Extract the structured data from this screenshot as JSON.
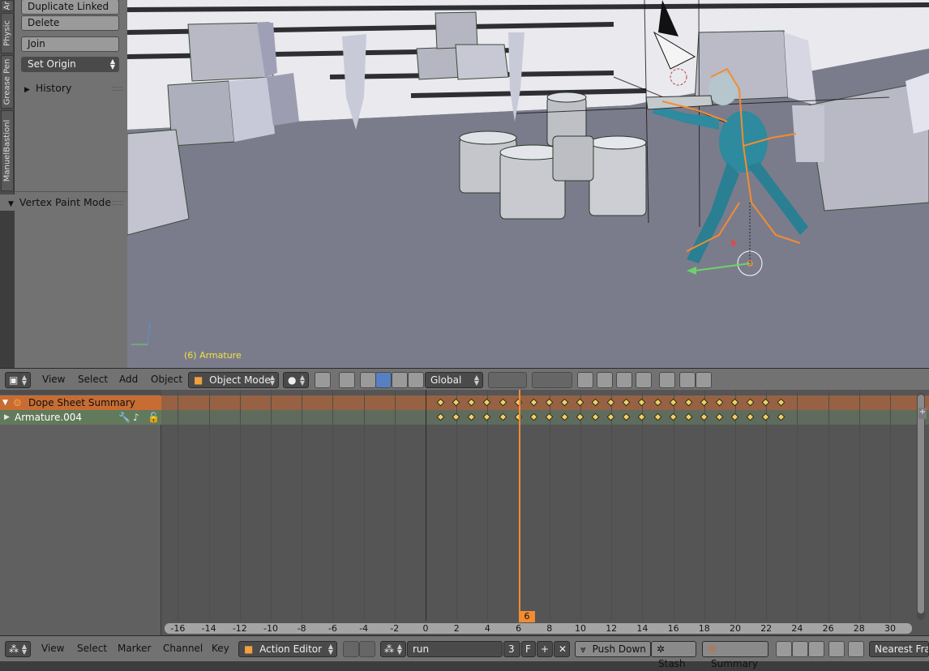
{
  "tool_panel": {
    "tabs": [
      "Ar",
      "Physic",
      "Grease Pen",
      "ManuelBastionl"
    ],
    "buttons": {
      "duplicate_linked": "Duplicate Linked",
      "delete": "Delete",
      "join": "Join",
      "set_origin": "Set Origin"
    },
    "history_label": "History",
    "vertex_paint_label": "Vertex Paint Mode"
  },
  "viewport": {
    "object_label": "(6) Armature"
  },
  "view3d_header": {
    "menus": [
      "View",
      "Select",
      "Add",
      "Object"
    ],
    "mode": "Object Mode",
    "orientation": "Global"
  },
  "dope_sheet": {
    "channels": [
      {
        "label": "Dope Sheet Summary",
        "selected": true
      },
      {
        "label": "Armature.004",
        "selected": false
      }
    ],
    "current_frame": "6",
    "frames": [
      1,
      2,
      3,
      4,
      5,
      6,
      7,
      8,
      9,
      10,
      11,
      12,
      13,
      14,
      15,
      16,
      17,
      18,
      19,
      20,
      21,
      22,
      23
    ],
    "ruler_labels": [
      "-16",
      "-14",
      "-12",
      "-10",
      "-8",
      "-6",
      "-4",
      "-2",
      "0",
      "2",
      "4",
      "6",
      "8",
      "10",
      "12",
      "14",
      "16",
      "18",
      "20",
      "22",
      "24",
      "26",
      "28",
      "30"
    ]
  },
  "bottom_header": {
    "menus": [
      "View",
      "Select",
      "Marker",
      "Channel",
      "Key"
    ],
    "editor_mode": "Action Editor",
    "action_name": "run",
    "users": "3",
    "fake_user": "F",
    "push_down": "Push Down",
    "stash": "Stash",
    "summary": "Summary",
    "snap": "Nearest Fram"
  },
  "colors": {
    "accent_orange": "#f28c32",
    "summary_row": "#a5613a",
    "selected_blue": "#5680c2",
    "keyframe": "#f0d060"
  }
}
